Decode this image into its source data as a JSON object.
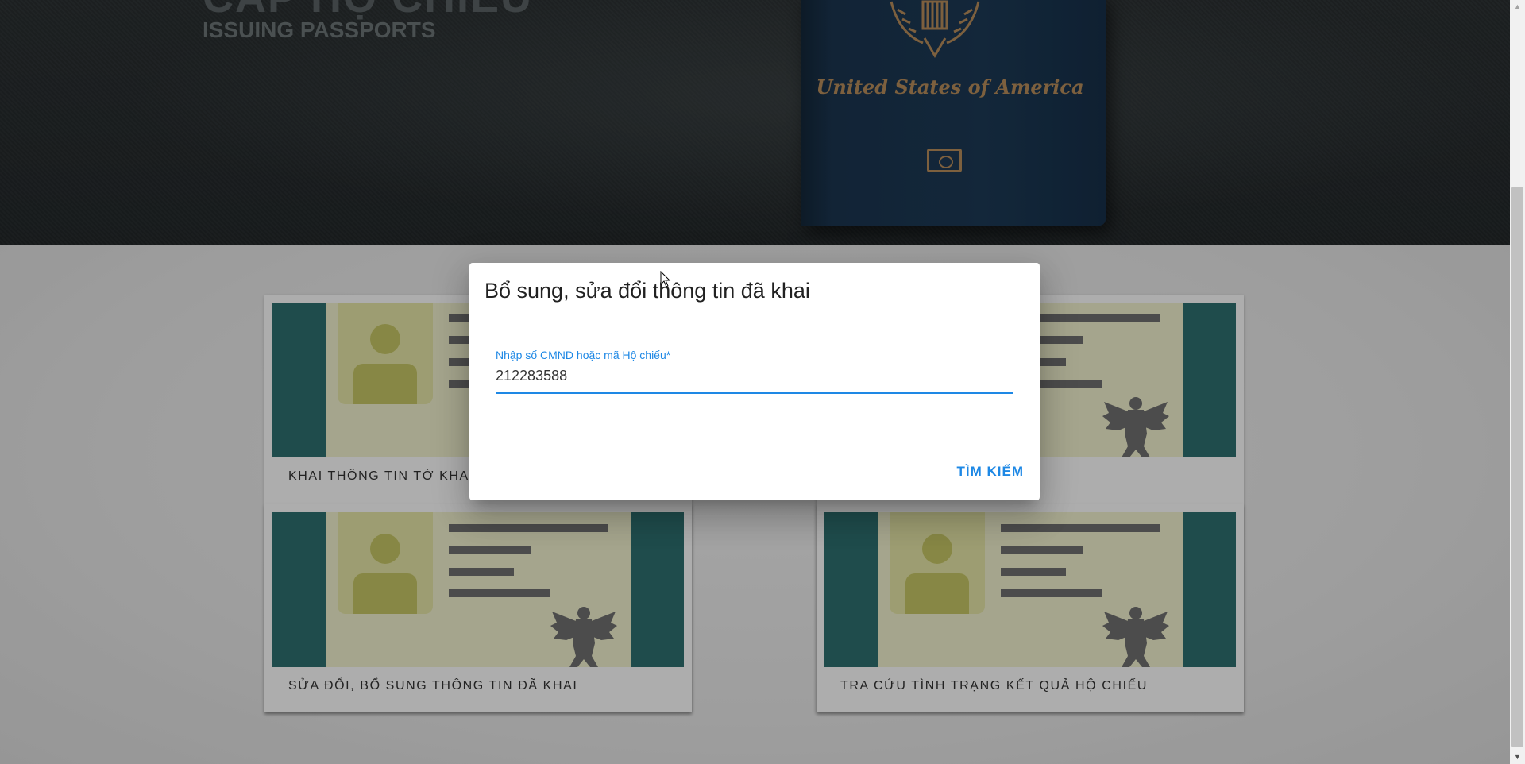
{
  "hero": {
    "title": "CẤP HỘ CHIẾU",
    "subtitle": "ISSUING PASSPORTS",
    "passport_country": "United States of America"
  },
  "cards": [
    {
      "label": "KHAI THÔNG TIN TỜ KHAI"
    },
    {
      "label": ""
    },
    {
      "label": "SỬA ĐỔI, BỔ SUNG THÔNG TIN ĐÃ KHAI"
    },
    {
      "label": "TRA CỨU TÌNH TRẠNG KẾT QUẢ HỘ CHIẾU"
    }
  ],
  "dialog": {
    "title": "Bổ sung, sửa đổi thông tin đã khai",
    "field_label": "Nhập số CMND hoặc mã Hộ chiếu*",
    "field_value": "212283588",
    "search_label": "TÌM KIẾM"
  },
  "colors": {
    "accent": "#1e88e5",
    "card_band": "#2f7070",
    "passport_gold": "#b98e5c"
  },
  "icons": {
    "card_emblem": "eagle-icon",
    "passport_emblem": "eagle-seal-icon"
  }
}
